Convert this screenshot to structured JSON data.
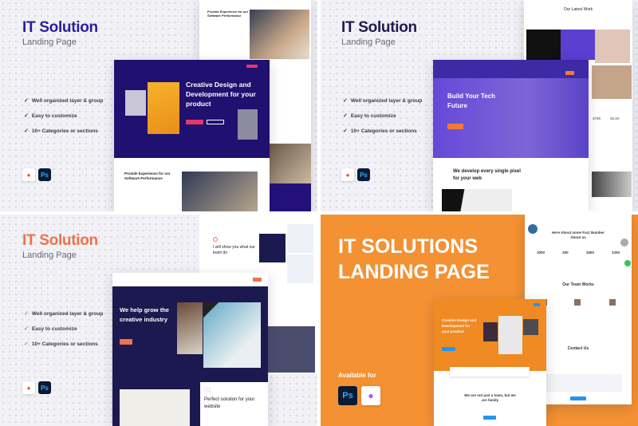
{
  "panels": [
    {
      "title": "IT Solution",
      "subtitle": "Landing Page",
      "accent": "#2b1d9e",
      "features": [
        "Well organized layer & group",
        "Easy to customize",
        "10+ Categories or sections"
      ],
      "tools": [
        "figma-icon",
        "photoshop-icon"
      ],
      "mockup": {
        "hero": "Creative Design and Development for your product",
        "section": "Provide Experience for our Software Performance",
        "card": "Provide Experience for our Software Performance"
      }
    },
    {
      "title": "IT Solution",
      "subtitle": "Landing Page",
      "accent": "#1e1a4f",
      "features": [
        "Well organized layer & group",
        "Easy to customize",
        "10+ Categories or sections"
      ],
      "tools": [
        "figma-icon",
        "photoshop-icon"
      ],
      "mockup": {
        "hero": "Build Your Tech Future",
        "section": "We develop every single pixel for your web",
        "card": "Our Latest Work",
        "stats": [
          "375K",
          "35.2K"
        ]
      }
    },
    {
      "title": "IT Solution",
      "subtitle": "Landing Page",
      "accent": "#f0714a",
      "features": [
        "Well organized layer & group",
        "Easy to customize",
        "10+ Categories or sections"
      ],
      "tools": [
        "figma-icon",
        "photoshop-icon"
      ],
      "mockup": {
        "hero": "We help grow the creative industry",
        "section_num": "01",
        "section": "Perfect solution for your website",
        "card": "I will show you what our team do"
      }
    },
    {
      "title_line1": "IT SOLUTIONS",
      "title_line2": "LANDING PAGE",
      "accent": "#f39133",
      "available": "Available for",
      "tools": [
        "photoshop-icon",
        "figma-icon"
      ],
      "mockup": {
        "hero": "Creative Design and Development for your product",
        "section": "We are not just a team, but we are family",
        "fact_title": "Here About some Fact Number About us",
        "stats": [
          "1000",
          "200",
          "1500",
          "1200"
        ],
        "team": "Our Team Works",
        "contact": "Contact Us"
      }
    }
  ],
  "tool_labels": {
    "ps": "Ps"
  }
}
